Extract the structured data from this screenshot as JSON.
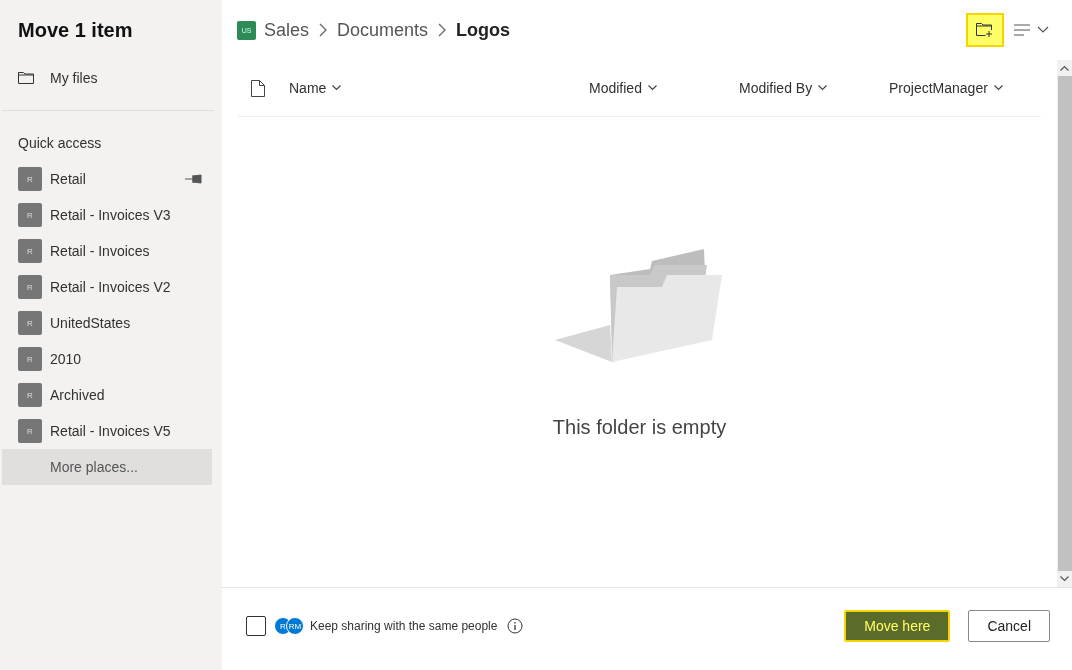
{
  "dialog": {
    "title": "Move 1 item"
  },
  "sidebar": {
    "my_files": "My files",
    "section_title": "Quick access",
    "items": [
      {
        "label": "Retail",
        "initial": "R",
        "pinned": true
      },
      {
        "label": "Retail - Invoices V3",
        "initial": "R",
        "pinned": false
      },
      {
        "label": "Retail - Invoices",
        "initial": "R",
        "pinned": false
      },
      {
        "label": "Retail - Invoices V2",
        "initial": "R",
        "pinned": false
      },
      {
        "label": "UnitedStates",
        "initial": "R",
        "pinned": false
      },
      {
        "label": "2010",
        "initial": "R",
        "pinned": false
      },
      {
        "label": "Archived",
        "initial": "R",
        "pinned": false
      },
      {
        "label": "Retail - Invoices V5",
        "initial": "R",
        "pinned": false
      }
    ],
    "more_places": {
      "label": "More places...",
      "selected": true
    }
  },
  "breadcrumb": {
    "site_badge": "US",
    "items": [
      {
        "label": "Sales",
        "current": false
      },
      {
        "label": "Documents",
        "current": false
      },
      {
        "label": "Logos",
        "current": true
      }
    ]
  },
  "toolbar": {
    "new_folder_highlighted": true
  },
  "table": {
    "columns": [
      "Name",
      "Modified",
      "Modified By",
      "ProjectManager"
    ]
  },
  "empty_message": "This folder is empty",
  "footer": {
    "checkbox": {
      "checked": false,
      "label": "Keep sharing with the same people"
    },
    "avatars": [
      "R",
      "RM"
    ],
    "buttons": [
      {
        "label": "Move here",
        "kind": "primary",
        "highlighted": true
      },
      {
        "label": "Cancel",
        "kind": "secondary",
        "highlighted": false
      }
    ]
  }
}
